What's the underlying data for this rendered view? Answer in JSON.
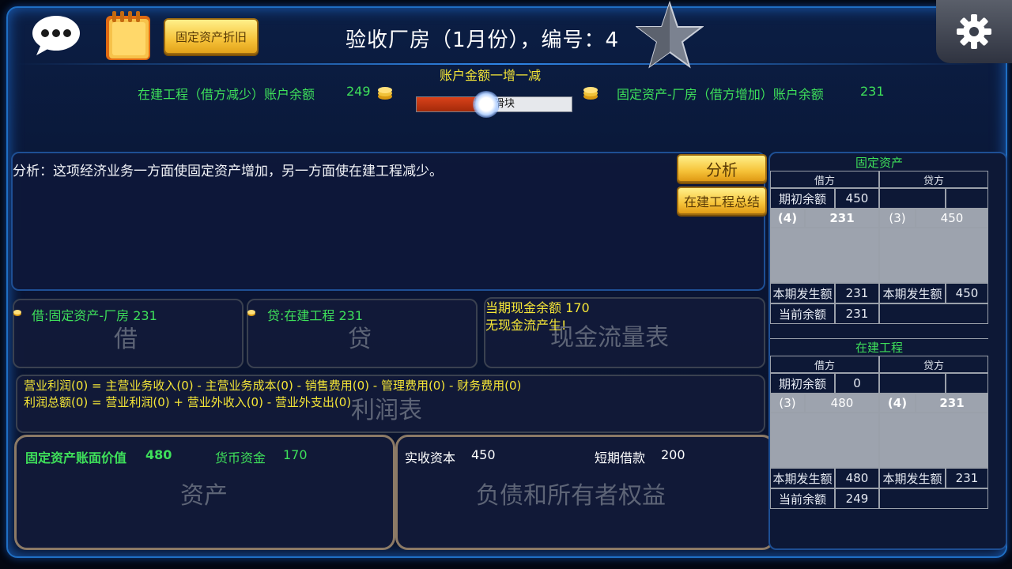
{
  "header": {
    "title": "验收厂房（1月份），编号：4",
    "depreciation_button": "固定资产折旧"
  },
  "transfer": {
    "left_account_label": "在建工程（借方减少）账户余额",
    "left_account_value": "249",
    "change_label": "账户金额一增一减",
    "slider_text": "拖动滑块",
    "slider_level_percent": 45,
    "right_account_label": "固定资产-厂房（借方增加）账户余额",
    "right_account_value": "231"
  },
  "analysis": {
    "text": "分析：这项经济业务一方面使固定资产增加，另一方面使在建工程减少。",
    "analyze_button": "分析",
    "summary_button": "在建工程总结"
  },
  "entries": {
    "debit_text": "借:固定资产-厂房   231",
    "debit_title": "借",
    "credit_text": "贷:在建工程   231",
    "credit_title": "贷"
  },
  "cash_flow": {
    "line1": "当期现金余额    170",
    "line2": "无现金流产生!",
    "title": "现金流量表"
  },
  "profit": {
    "line1": "营业利润(0) = 主营业务收入(0) - 主营业务成本(0) - 销售费用(0) - 管理费用(0) - 财务费用(0)",
    "line2": "利润总额(0) = 营业利润(0) + 营业外收入(0) - 营业外支出(0)",
    "title": "利润表"
  },
  "assets": {
    "fixed_label": "固定资产账面价值",
    "fixed_value": "480",
    "cash_label": "货币资金",
    "cash_value": "170",
    "title": "资产"
  },
  "liabilities": {
    "capital_label": "实收资本",
    "capital_value": "450",
    "loan_label": "短期借款",
    "loan_value": "200",
    "title": "负债和所有者权益"
  },
  "ledger_fixed": {
    "title": "固定资产",
    "debit_head": "借方",
    "credit_head": "贷方",
    "opening_label": "期初余额",
    "opening_value": "450",
    "entry_debit_no": "(4)",
    "entry_debit_value": "231",
    "entry_credit_no": "(3)",
    "entry_credit_value": "450",
    "period_label": "本期发生额",
    "period_debit": "231",
    "period_credit_label": "本期发生额",
    "period_credit": "450",
    "current_label": "当前余额",
    "current_value": "231"
  },
  "ledger_cip": {
    "title": "在建工程",
    "debit_head": "借方",
    "credit_head": "贷方",
    "opening_label": "期初余额",
    "opening_value": "0",
    "entry_debit_no": "(3)",
    "entry_debit_value": "480",
    "entry_credit_no": "(4)",
    "entry_credit_value": "231",
    "period_label": "本期发生额",
    "period_debit": "480",
    "period_credit_label": "本期发生额",
    "period_credit": "231",
    "current_label": "当前余额",
    "current_value": "249"
  },
  "colors": {
    "green": "#3ee05a",
    "yellow": "#f5e637",
    "frame_blue": "#1f6fc4"
  }
}
